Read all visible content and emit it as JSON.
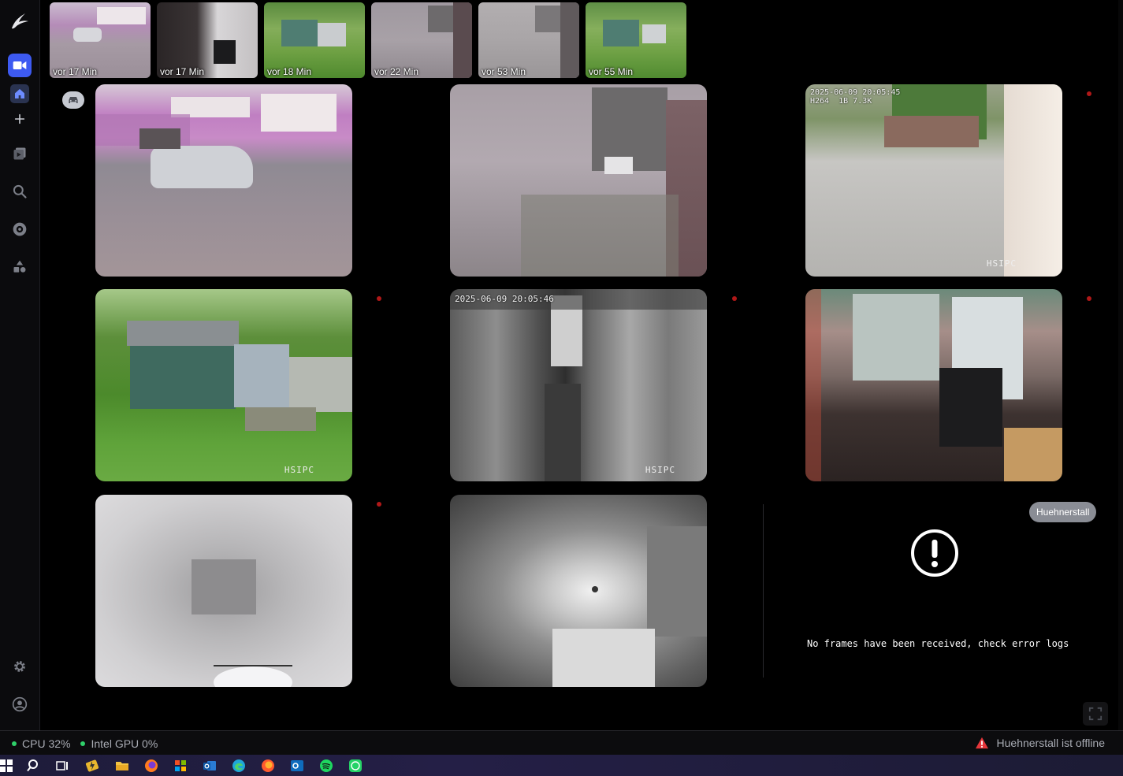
{
  "app": {
    "logo_icon": "bird-logo-icon",
    "accent": "#3d5af1"
  },
  "sidebar": {
    "items": [
      {
        "name": "cameras",
        "icon": "video-camera-icon",
        "active": true
      },
      {
        "name": "home",
        "icon": "home-icon",
        "active": true
      },
      {
        "name": "add",
        "icon": "plus-icon"
      },
      {
        "name": "recordings",
        "icon": "playback-icon"
      },
      {
        "name": "search",
        "icon": "search-icon"
      },
      {
        "name": "dashboard",
        "icon": "disc-icon"
      },
      {
        "name": "plugins",
        "icon": "shapes-icon"
      },
      {
        "name": "settings",
        "icon": "gear-icon"
      },
      {
        "name": "account",
        "icon": "user-icon"
      }
    ]
  },
  "thumbnails": [
    {
      "label": "vor 17 Min"
    },
    {
      "label": "vor 17 Min"
    },
    {
      "label": "vor 18 Min"
    },
    {
      "label": "vor 22 Min"
    },
    {
      "label": "vor 53 Min"
    },
    {
      "label": "vor 55 Min"
    }
  ],
  "cameras": [
    {
      "id": "cam1",
      "stamp": ""
    },
    {
      "id": "cam2",
      "stamp": ""
    },
    {
      "id": "cam3",
      "stamp": "2025-06-09 20:05:45\nH264  1B 7.3K",
      "brand": "HSIPC"
    },
    {
      "id": "cam4",
      "brand": "HSIPC"
    },
    {
      "id": "cam5",
      "stamp": "2025-06-09 20:05:46",
      "brand": "HSIPC"
    },
    {
      "id": "cam6"
    },
    {
      "id": "cam7"
    },
    {
      "id": "cam8"
    }
  ],
  "offline_camera": {
    "name": "Huehnerstall",
    "message": "No frames have been received, check error logs"
  },
  "status": {
    "cpu": "CPU 32%",
    "gpu": "Intel GPU 0%",
    "alert": "Huehnerstall ist offline",
    "ok_color": "#2fd06a",
    "alert_color": "#e5363a"
  }
}
